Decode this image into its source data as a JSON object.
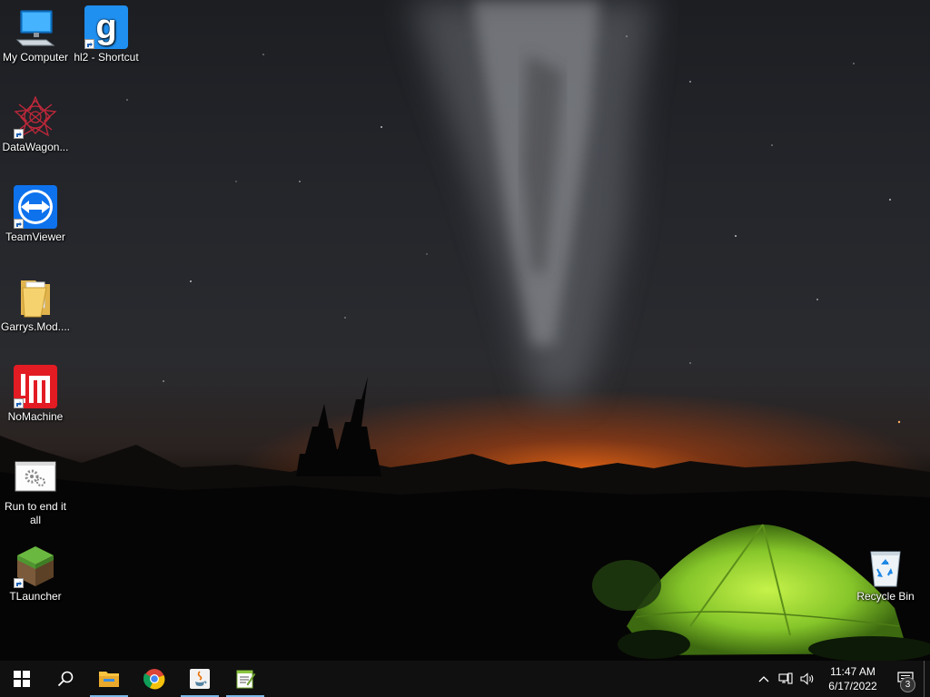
{
  "desktop": {
    "icons": [
      {
        "label": "My Computer",
        "icon": "computer-icon"
      },
      {
        "label": "hl2 - Shortcut",
        "icon": "garrys-mod-icon"
      },
      {
        "label": "DataWagon...",
        "icon": "datawagon-icon"
      },
      {
        "label": "TeamViewer",
        "icon": "teamviewer-icon"
      },
      {
        "label": "Garrys.Mod....",
        "icon": "folder-icon"
      },
      {
        "label": "NoMachine",
        "icon": "nomachine-icon"
      },
      {
        "label": "Run to end it all",
        "icon": "settings-window-icon"
      },
      {
        "label": "TLauncher",
        "icon": "minecraft-icon"
      },
      {
        "label": "Recycle Bin",
        "icon": "recycle-bin-icon"
      }
    ]
  },
  "taskbar": {
    "apps": [
      {
        "name": "File Explorer",
        "icon": "file-explorer-icon"
      },
      {
        "name": "Google Chrome",
        "icon": "chrome-icon"
      },
      {
        "name": "Java",
        "icon": "java-icon"
      },
      {
        "name": "Notepad++",
        "icon": "notepad-icon"
      }
    ],
    "clock": {
      "time": "11:47 AM",
      "date": "6/17/2022"
    },
    "notification_count": "3"
  },
  "colors": {
    "taskbar": "#101010",
    "accent": "#7db7e8",
    "tent": "#8fd12a"
  }
}
